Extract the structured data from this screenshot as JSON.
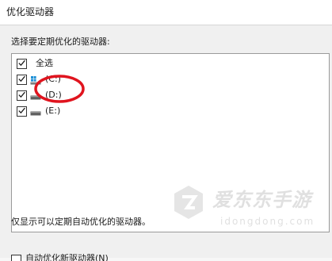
{
  "window": {
    "title": "优化驱动器"
  },
  "drives_section": {
    "label": "选择要定期优化的驱动器:",
    "select_all_label": "全选",
    "select_all_checked": true,
    "drives": [
      {
        "label": "(C:)",
        "icon": "windows-drive-icon",
        "checked": true
      },
      {
        "label": "(D:)",
        "icon": "hard-drive-icon",
        "checked": true
      },
      {
        "label": "(E:)",
        "icon": "hard-drive-icon",
        "checked": true
      }
    ]
  },
  "footer": {
    "note": "仅显示可以定期自动优化的驱动器。",
    "auto_optimize_label": "自动优化新驱动器(N)"
  },
  "watermark": {
    "brand_text": "爱东东手游",
    "site_text": "idongdong.com"
  },
  "annotation": {
    "circle_color": "#e0141e"
  }
}
